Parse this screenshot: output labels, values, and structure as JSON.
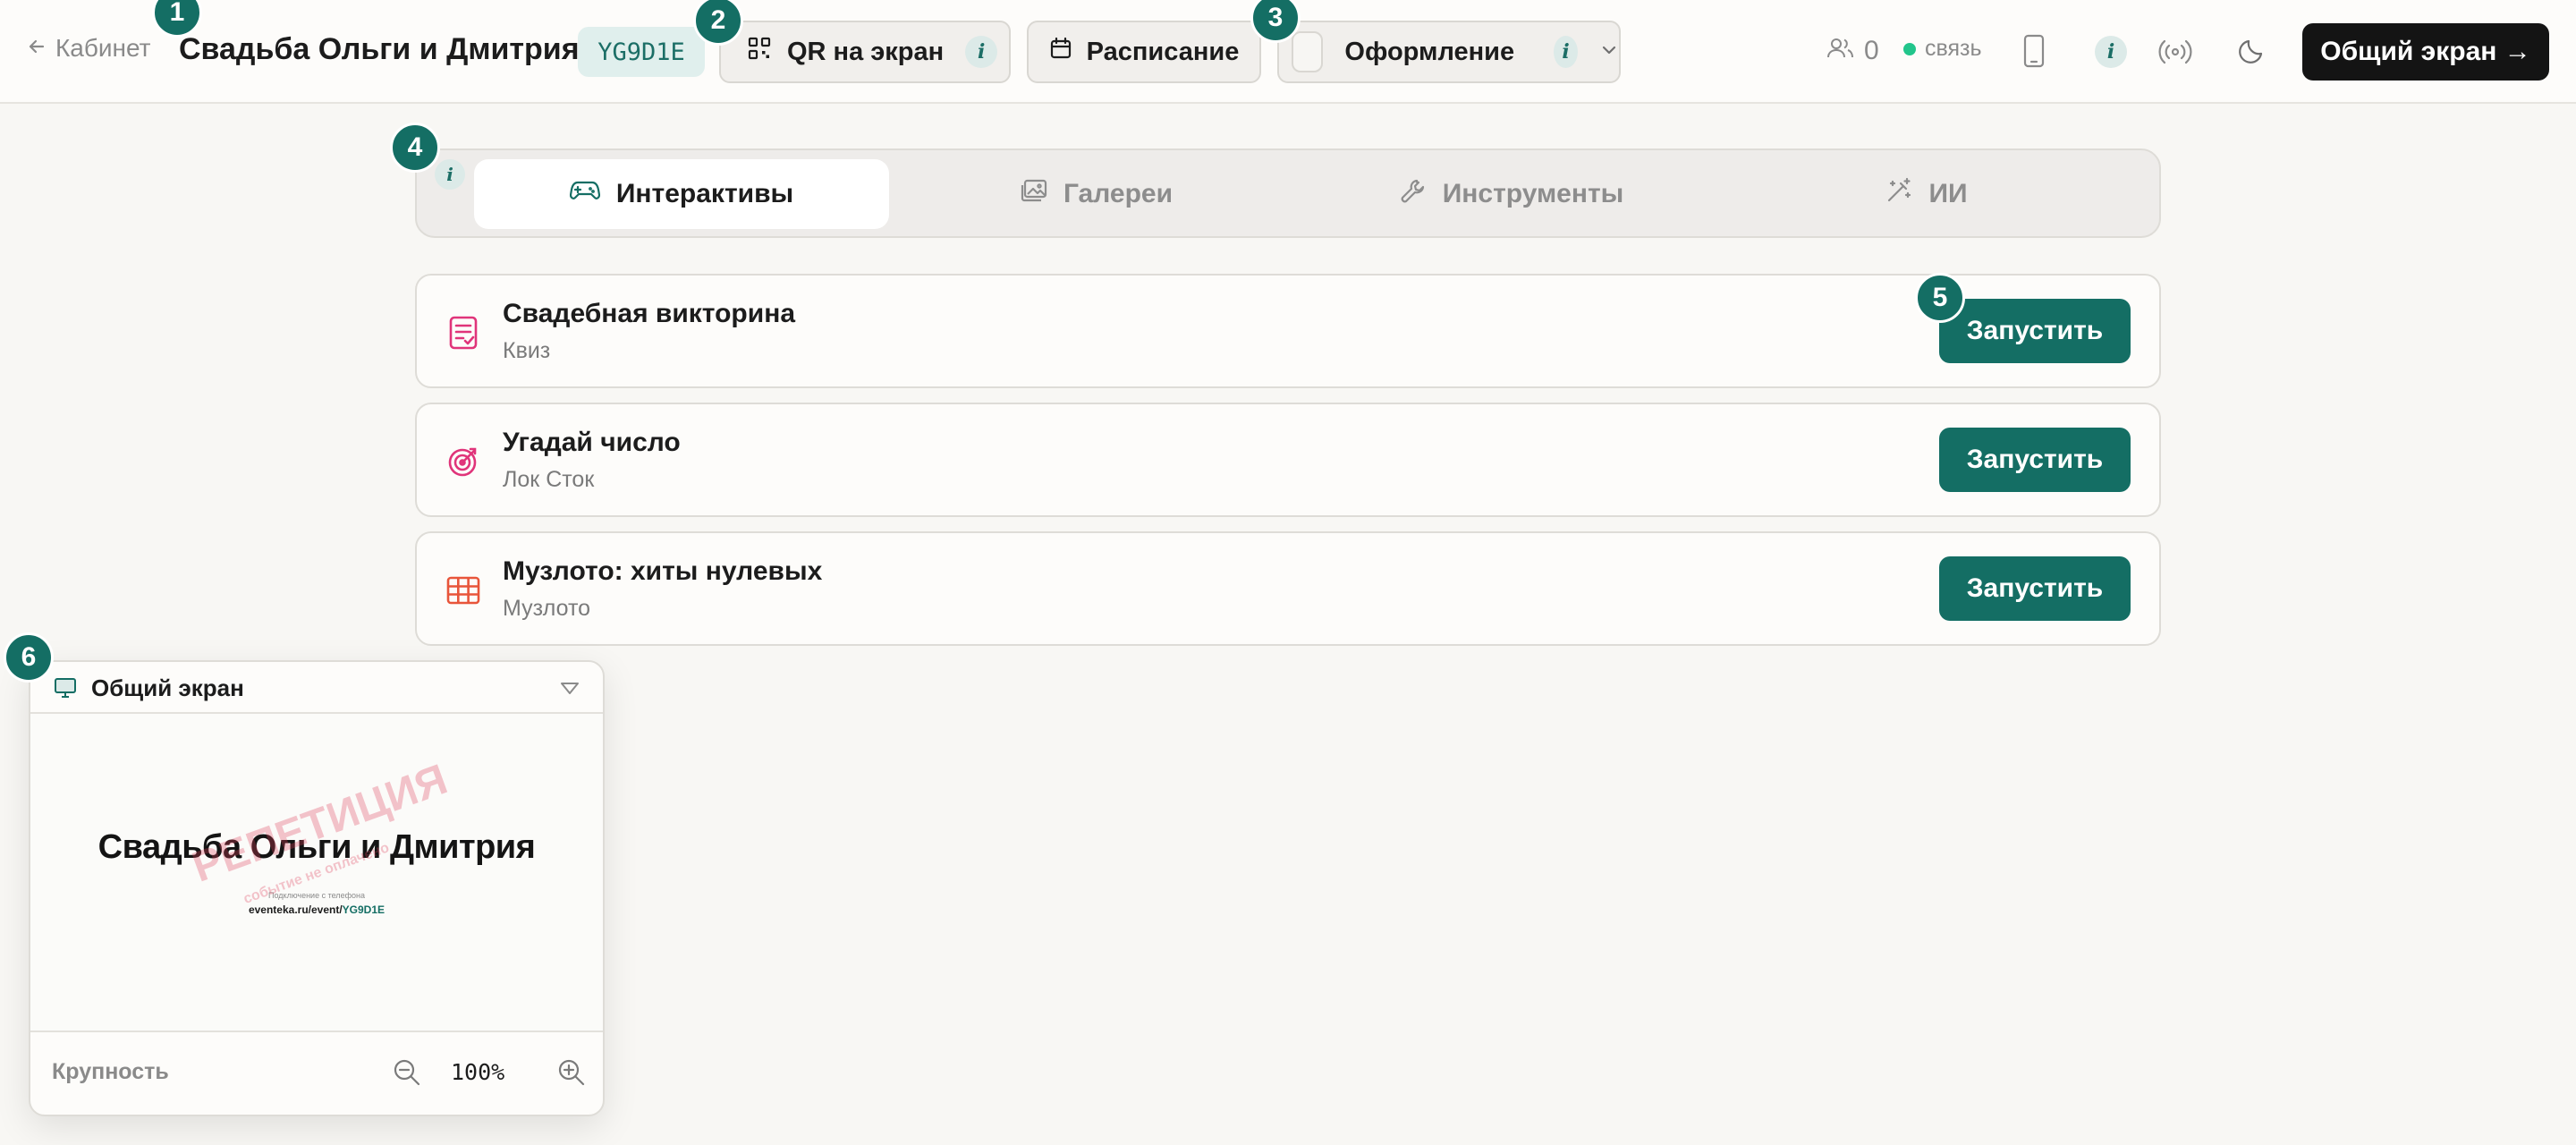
{
  "header": {
    "back_label": "Кабинет",
    "event_title": "Свадьба Ольги и Дмитрия",
    "event_code": "YG9D1E",
    "qr_label": "QR на экран",
    "schedule_label": "Расписание",
    "design_label": "Оформление",
    "participants_count": "0",
    "connection_label": "связь",
    "share_screen_label": "Общий экран →",
    "info_glyph": "i"
  },
  "markers": [
    "1",
    "2",
    "3",
    "4",
    "5",
    "6"
  ],
  "tabs": [
    {
      "label": "Интерактивы",
      "icon": "gamepad-icon",
      "active": true
    },
    {
      "label": "Галереи",
      "icon": "image-icon",
      "active": false
    },
    {
      "label": "Инструменты",
      "icon": "wrench-icon",
      "active": false
    },
    {
      "label": "ИИ",
      "icon": "magic-wand-icon",
      "active": false
    }
  ],
  "activities": [
    {
      "title": "Свадебная викторина",
      "subtitle": "Квиз",
      "icon": "quiz-icon",
      "color": "#e0347a",
      "button": "Запустить"
    },
    {
      "title": "Угадай число",
      "subtitle": "Лок Сток",
      "icon": "target-icon",
      "color": "#e0347a",
      "button": "Запустить"
    },
    {
      "title": "Музлото: хиты нулевых",
      "subtitle": "Музлото",
      "icon": "grid-icon",
      "color": "#e8553a",
      "button": "Запустить"
    }
  ],
  "preview": {
    "header_label": "Общий экран",
    "screen_title": "Свадьба Ольги и Дмитрия",
    "screen_hint": "Подключение с телефона",
    "screen_url_prefix": "eventeka.ru/event/",
    "screen_url_code": "YG9D1E",
    "watermark": "РЕПЕТИЦИЯ",
    "watermark_sub": "событие не оплачено",
    "size_label": "Крупность",
    "zoom_value": "100%"
  },
  "colors": {
    "accent": "#146e64",
    "pink": "#e0347a",
    "orange": "#e8553a",
    "online": "#22c58b",
    "dark_button": "#141414"
  }
}
